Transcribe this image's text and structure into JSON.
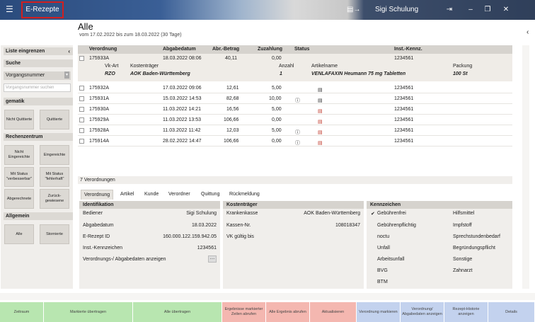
{
  "titlebar": {
    "app_title": "E-Rezepte",
    "user_name": "Sigi Schulung"
  },
  "page": {
    "title": "Alle",
    "date_range": "vom 17.02.2022 bis zum 18.03.2022 (30 Tage)"
  },
  "sidebar": {
    "header": "Liste eingrenzen",
    "search_header": "Suche",
    "search_select": "Vorgangsnummer",
    "search_placeholder": "Vorgangsnummer suchen",
    "gematik_header": "gematik",
    "gematik_buttons": [
      "Nicht Quittierte",
      "Quittierte"
    ],
    "rechenzentrum_header": "Rechenzentrum",
    "rz_buttons": [
      "Nicht Eingereichte",
      "Eingereichte",
      "Mit Status \"verbesserbar\"",
      "Mit Status \"fehlerhaft\"",
      "Abgerechnete",
      "Zurück-gewiesene"
    ],
    "allgemein_header": "Allgemein",
    "allgemein_buttons": [
      "Alle",
      "Stornierte"
    ]
  },
  "table": {
    "headers": [
      "Verordnung",
      "Abgabedatum",
      "Abr.-Betrag",
      "Zuzahlung",
      "Status",
      "Inst.-Kennz."
    ],
    "expanded": {
      "verordnung": "175933A",
      "datum": "18.03.2022 08:06",
      "betrag": "40,11",
      "zuzahlung": "0,00",
      "inst": "1234561",
      "sub_headers": [
        "Vk-Art",
        "Kostenträger",
        "Anzahl",
        "Artikelname",
        "Packung"
      ],
      "vk_art": "RZO",
      "kostentraeger": "AOK Baden-Württemberg",
      "anzahl": "1",
      "artikelname": "VENLAFAXIN Heumann 75 mg Tabletten",
      "packung": "100 St"
    },
    "rows": [
      {
        "verordnung": "175932A",
        "datum": "17.03.2022 09:06",
        "betrag": "12,61",
        "zuzahlung": "5,00",
        "inst": "1234561"
      },
      {
        "verordnung": "175931A",
        "datum": "15.03.2022 14:53",
        "betrag": "82,68",
        "zuzahlung": "10,00",
        "inst": "1234561"
      },
      {
        "verordnung": "175930A",
        "datum": "11.03.2022 14:21",
        "betrag": "16,56",
        "zuzahlung": "5,00",
        "inst": "1234561"
      },
      {
        "verordnung": "175929A",
        "datum": "11.03.2022 13:53",
        "betrag": "106,66",
        "zuzahlung": "0,00",
        "inst": "1234561"
      },
      {
        "verordnung": "175928A",
        "datum": "11.03.2022 11:42",
        "betrag": "12,03",
        "zuzahlung": "5,00",
        "inst": "1234561"
      },
      {
        "verordnung": "175914A",
        "datum": "28.02.2022 14:47",
        "betrag": "106,66",
        "zuzahlung": "0,00",
        "inst": "1234561"
      }
    ],
    "count": "7 Verordnungen"
  },
  "tabs": [
    "Verordnung",
    "Artikel",
    "Kunde",
    "Verordner",
    "Quittung",
    "Rückmeldung"
  ],
  "identifikation": {
    "header": "Identifikation",
    "labels": [
      "Bediener",
      "Abgabedatum",
      "E-Rezept ID",
      "Inst.-Kennzeichen",
      "Verordnungs-/ Abgabedaten anzeigen"
    ],
    "values": [
      "Sigi Schulung",
      "18.03.2022",
      "160.000.122.159.942.05",
      "1234561"
    ]
  },
  "kostentraeger": {
    "header": "Kostenträger",
    "labels": [
      "Krankenkasse",
      "Kassen-Nr.",
      "VK gültig bis"
    ],
    "values": [
      "AOK Baden-Württemberg",
      "108018347",
      ""
    ]
  },
  "kennzeichen": {
    "header": "Kennzeichen",
    "left": [
      "Gebührenfrei",
      "Gebührenpflichtig",
      "noctu",
      "Unfall",
      "Arbeitsunfall",
      "BVG",
      "BTM"
    ],
    "right": [
      "Hilfsmittel",
      "Impfstoff",
      "Sprechstundenbedarf",
      "Begründungspflicht",
      "Sonstige",
      "Zahnarzt"
    ]
  },
  "buttons": [
    {
      "label": "Zeitraum",
      "color": "#b8e6b0"
    },
    {
      "label": "Markierte übertragen",
      "color": "#b8e6b0"
    },
    {
      "label": "Alle übertragen",
      "color": "#b8e6b0"
    },
    {
      "label": "Ergebnisse markierter Zeilen abrufen",
      "color": "#f4b7b0"
    },
    {
      "label": "Alle Ergebnis abrufen",
      "color": "#f4b7b0"
    },
    {
      "label": "Aktualisieren",
      "color": "#f4b7b0"
    },
    {
      "label": "Verordnung markieren",
      "color": "#c3d2ee"
    },
    {
      "label": "Verordnung/ Abgabedaten anzeigen",
      "color": "#c3d2ee"
    },
    {
      "label": "Rezept-Historie anzeigen",
      "color": "#c3d2ee"
    },
    {
      "label": "Details",
      "color": "#c3d2ee"
    }
  ]
}
